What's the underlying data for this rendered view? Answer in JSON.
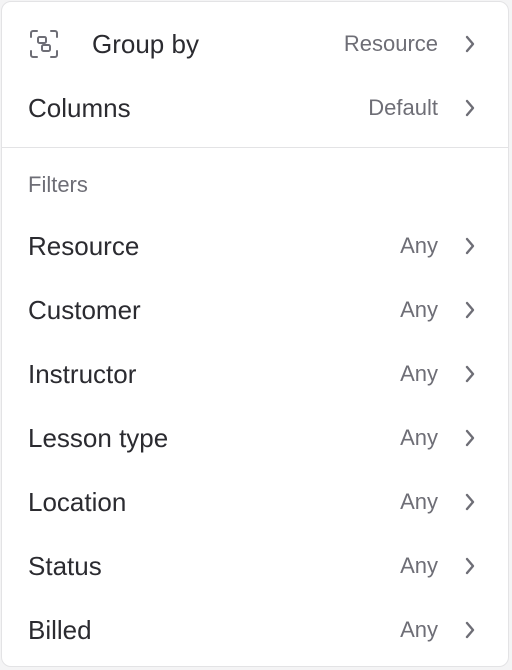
{
  "menu": {
    "group_by": {
      "label": "Group by",
      "value": "Resource",
      "icon": "group-icon"
    },
    "columns": {
      "label": "Columns",
      "value": "Default"
    },
    "filters": {
      "title": "Filters",
      "items": [
        {
          "label": "Resource",
          "value": "Any"
        },
        {
          "label": "Customer",
          "value": "Any"
        },
        {
          "label": "Instructor",
          "value": "Any"
        },
        {
          "label": "Lesson type",
          "value": "Any"
        },
        {
          "label": "Location",
          "value": "Any"
        },
        {
          "label": "Status",
          "value": "Any"
        },
        {
          "label": "Billed",
          "value": "Any"
        }
      ]
    }
  },
  "colors": {
    "text": "#2b2b30",
    "muted": "#6e6e76",
    "border": "#e3e3e5"
  }
}
